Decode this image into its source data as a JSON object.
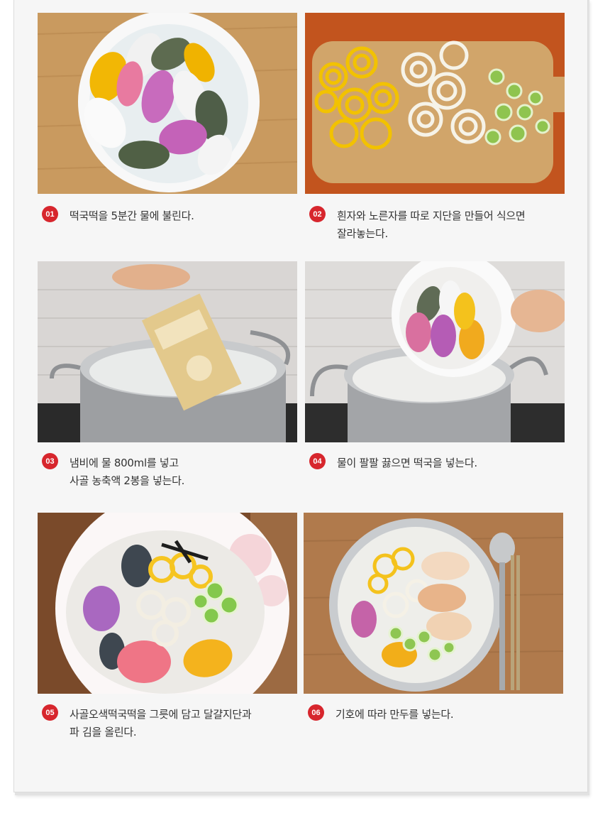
{
  "colors": {
    "badge": "#d7262d",
    "text": "#333333"
  },
  "steps": [
    {
      "number": "01",
      "text": "떡국떡을 5분간 물에 불린다."
    },
    {
      "number": "02",
      "text": "흰자와 노른자를 따로 지단을 만들어 식으면\n잘라놓는다."
    },
    {
      "number": "03",
      "text": "냄비에 물 800ml를 넣고\n사골 농축액 2봉을 넣는다."
    },
    {
      "number": "04",
      "text": "물이 팔팔 끓으면 떡국을 넣는다."
    },
    {
      "number": "05",
      "text": "사골오색떡국떡을 그릇에 담고 달걀지단과\n파 김을 올린다."
    },
    {
      "number": "06",
      "text": "기호에 따라 만두를 넣는다."
    }
  ]
}
